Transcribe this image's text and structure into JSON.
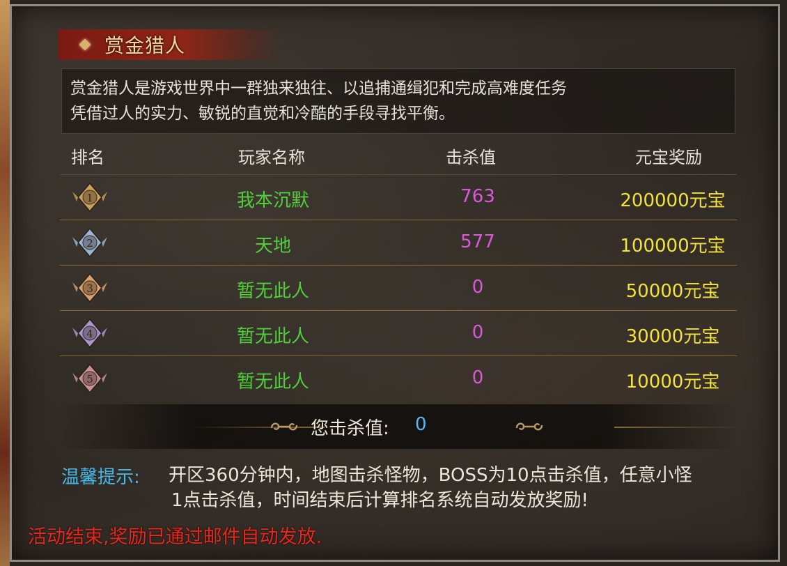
{
  "title": "赏金猎人",
  "description": [
    "赏金猎人是游戏世界中一群独来独往、以追捕通缉犯和完成高难度任务",
    "凭借过人的实力、敏锐的直觉和冷酷的手段寻找平衡。"
  ],
  "headers": {
    "rank": "排名",
    "name": "玩家名称",
    "kills": "击杀值",
    "reward": "元宝奖励"
  },
  "rows": [
    {
      "rank": "1",
      "name": "我本沉默",
      "kills": "763",
      "reward": "200000元宝",
      "badge_color": "#c8a060"
    },
    {
      "rank": "2",
      "name": "天地",
      "kills": "577",
      "reward": "100000元宝",
      "badge_color": "#9ab4d8"
    },
    {
      "rank": "3",
      "name": "暂无此人",
      "kills": "0",
      "reward": "50000元宝",
      "badge_color": "#d8a070"
    },
    {
      "rank": "4",
      "name": "暂无此人",
      "kills": "0",
      "reward": "30000元宝",
      "badge_color": "#a898d0"
    },
    {
      "rank": "5",
      "name": "暂无此人",
      "kills": "0",
      "reward": "10000元宝",
      "badge_color": "#c8909a"
    }
  ],
  "my_kills": {
    "label": "您击杀值:",
    "value": "0"
  },
  "tip": {
    "label": "温馨提示:",
    "lines": [
      "开区360分钟内，地图击杀怪物，BOSS为10点击杀值，任意小怪",
      "1点击杀值，时间结束后计算排名系统自动发放奖励!"
    ]
  },
  "status": "活动结束,奖励已通过邮件自动发放.",
  "colors": {
    "name": "#4fcf3a",
    "kills": "#d85ad8",
    "reward": "#f2e23a",
    "tip_label": "#46b8e8",
    "status": "#e8281e",
    "my_kill_value": "#5ab8f0"
  }
}
